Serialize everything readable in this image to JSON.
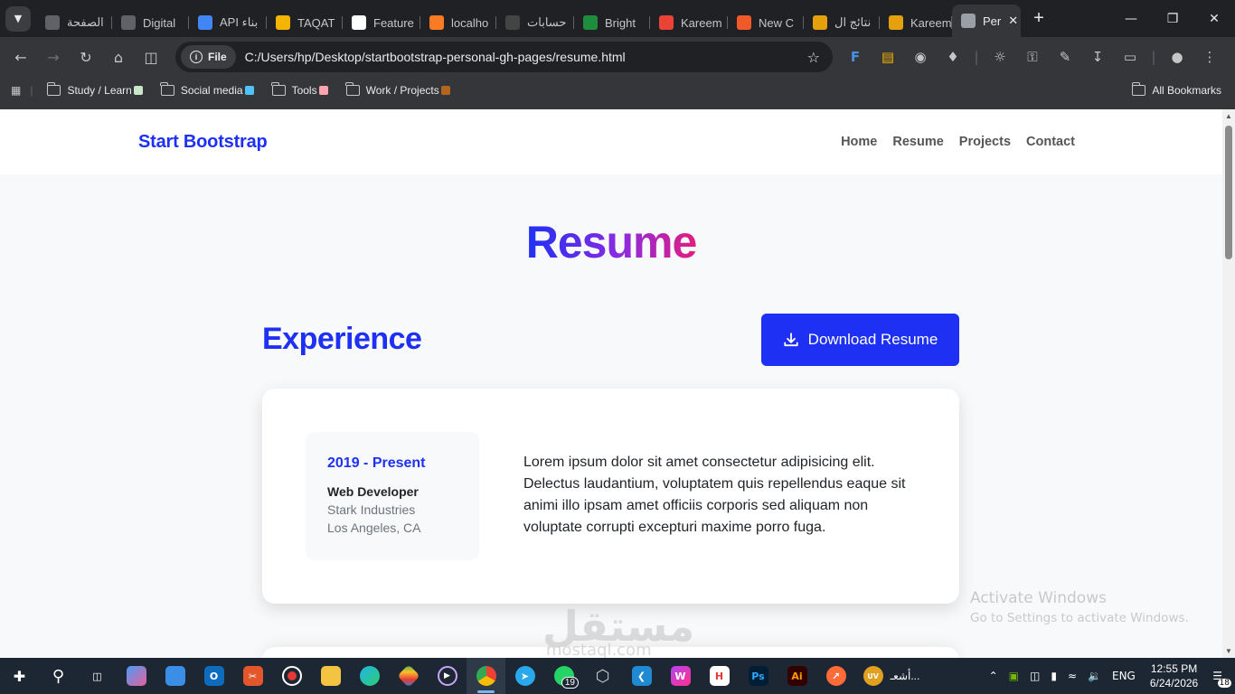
{
  "browser": {
    "tabs": [
      {
        "title": "الصفحة",
        "favicon": "globe-icon",
        "color": "#5f6368"
      },
      {
        "title": "Digital",
        "favicon": "globe-icon",
        "color": "#5f6368"
      },
      {
        "title": "API بناء",
        "favicon": "gemini-icon",
        "color": "#4285f4"
      },
      {
        "title": "TAQAT",
        "favicon": "taqat-icon",
        "color": "#f4b400"
      },
      {
        "title": "Feature",
        "favicon": "github-icon",
        "color": "#ffffff"
      },
      {
        "title": "localho",
        "favicon": "xampp-icon",
        "color": "#fb7a24"
      },
      {
        "title": "حسابات",
        "favicon": "dark-circle-icon",
        "color": "#444444"
      },
      {
        "title": "Bright",
        "favicon": "bright-icon",
        "color": "#1e8e3e"
      },
      {
        "title": "Kareem",
        "favicon": "gmail-icon",
        "color": "#ea4335"
      },
      {
        "title": "New C",
        "favicon": "cw-icon",
        "color": "#f05a28"
      },
      {
        "title": "نتائج ال",
        "favicon": "html5-icon",
        "color": "#e5a00d"
      },
      {
        "title": "Kareem.",
        "favicon": "html5-icon",
        "color": "#e5a00d"
      },
      {
        "title": "Per",
        "favicon": "globe-icon",
        "color": "#9aa0a6",
        "active": true
      }
    ],
    "address": {
      "chip": "File",
      "url": "C:/Users/hp/Desktop/startbootstrap-personal-gh-pages/resume.html"
    },
    "bookmarks": [
      {
        "label": "Study / Learn",
        "emoji_color": "#c8e6c9"
      },
      {
        "label": "Social media",
        "emoji_color": "#4fc3f7"
      },
      {
        "label": "Tools",
        "emoji_color": "#f8a5b0"
      },
      {
        "label": "Work / Projects",
        "emoji_color": "#b5651d"
      }
    ],
    "all_bookmarks": "All Bookmarks"
  },
  "site": {
    "brand": "Start Bootstrap",
    "nav": [
      "Home",
      "Resume",
      "Projects",
      "Contact"
    ],
    "page_title": "Resume",
    "experience_heading": "Experience",
    "download_button": "Download Resume",
    "experience": {
      "years": "2019 - Present",
      "role": "Web Developer",
      "company": "Stark Industries",
      "location": "Los Angeles, CA",
      "description": "Lorem ipsum dolor sit amet consectetur adipisicing elit. Delectus laudantium, voluptatem quis repellendus eaque sit animi illo ipsam amet officiis corporis sed aliquam non voluptate corrupti excepturi maxime porro fuga."
    },
    "accent_color": "#1e30f3"
  },
  "watermark": {
    "line1": "Activate Windows",
    "line2": "Go to Settings to activate Windows.",
    "mostaql": "مستقل",
    "mostaql_url": "mostaql.com"
  },
  "taskbar": {
    "whatsapp_badge": "19",
    "tray_app": "أشعـ...",
    "language": "ENG",
    "time": "12:55 PM",
    "date": "6/24/2026",
    "notifications": "18"
  }
}
